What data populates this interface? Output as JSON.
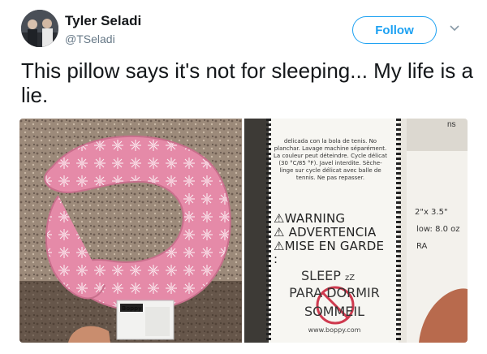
{
  "user": {
    "name": "Tyler Seladi",
    "handle": "@TSeladi"
  },
  "follow_label": "Follow",
  "tweet_text": "This pillow says it's not for sleeping... My life is a lie.",
  "label": {
    "fr_lines": "delicada con la bola de tenis. No planchar. Lavage machine séparément. La couleur peut déteindre. Cycle délicat (30 °C/85 °F). Javel interdite. Sèche-linge sur cycle délicat avec balle de tennis. Ne pas repasser.",
    "warning": "⚠WARNING",
    "advertencia": "⚠ ADVERTENCIA",
    "mise": "⚠MISE EN GARDE :",
    "sleep": "SLEEP",
    "zz": "zZ",
    "dormir": "PARA DORMIR",
    "sommeil": "SOMMEIL",
    "url": "www.boppy.com"
  },
  "side_card": {
    "dimensions": "2\"x 3.5\"",
    "flow": "low: 8.0 oz",
    "ra": "RA",
    "ns": "ns"
  },
  "tag_text": "Boppy",
  "colors": {
    "follow_blue": "#1da1f2",
    "handle_gray": "#657786",
    "pillow_pink": "#e58aa8"
  }
}
